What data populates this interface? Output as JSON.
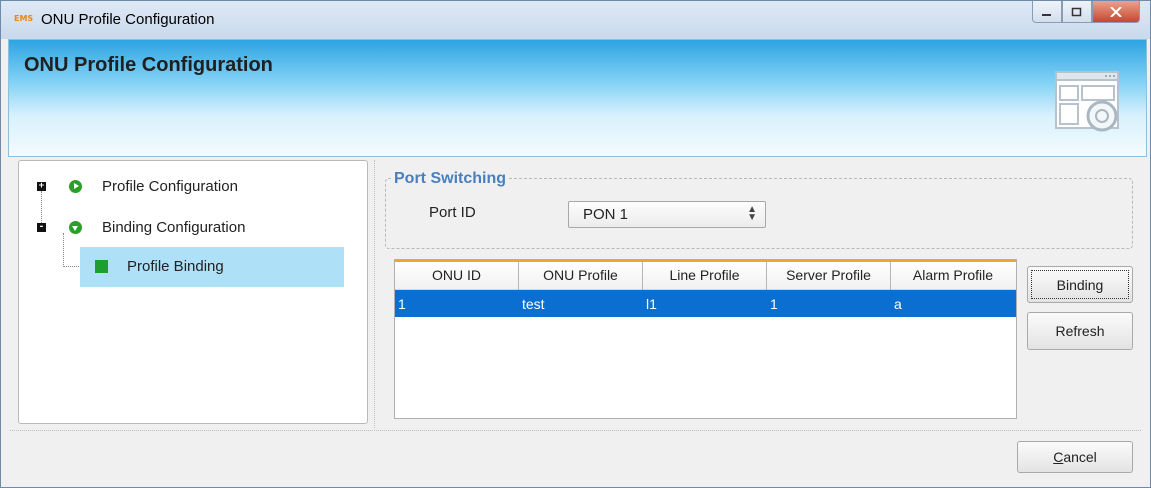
{
  "window": {
    "app_icon_text": "EMS",
    "title": "ONU Profile Configuration",
    "controls": [
      "minimize",
      "maximize",
      "close"
    ]
  },
  "header": {
    "title": "ONU Profile Configuration",
    "graphic_icon": "window-gear-graphic"
  },
  "tree": {
    "items": [
      {
        "label": "Profile Configuration",
        "expander": "+",
        "icon": "play-circle-icon"
      },
      {
        "label": "Binding Configuration",
        "expander": "-",
        "icon": "down-circle-icon",
        "children": [
          {
            "label": "Profile Binding",
            "icon": "green-square-icon",
            "selected": true
          }
        ]
      }
    ]
  },
  "port_switching": {
    "group_title": "Port Switching",
    "port_label": "Port ID",
    "port_value": "PON 1"
  },
  "table": {
    "columns": [
      "ONU ID",
      "ONU Profile",
      "Line Profile",
      "Server Profile",
      "Alarm Profile"
    ],
    "rows": [
      [
        "1",
        "test",
        "l1",
        "1",
        "a"
      ]
    ],
    "selected_row_color": "#0a6fd0",
    "header_accent_color": "#f1a52f"
  },
  "buttons": {
    "binding": "Binding",
    "refresh": "Refresh",
    "cancel": "Cancel"
  },
  "colors": {
    "header_blue": "#2ea4e3",
    "group_title": "#4a7fbf",
    "selection_bg": "#aee0f7"
  }
}
